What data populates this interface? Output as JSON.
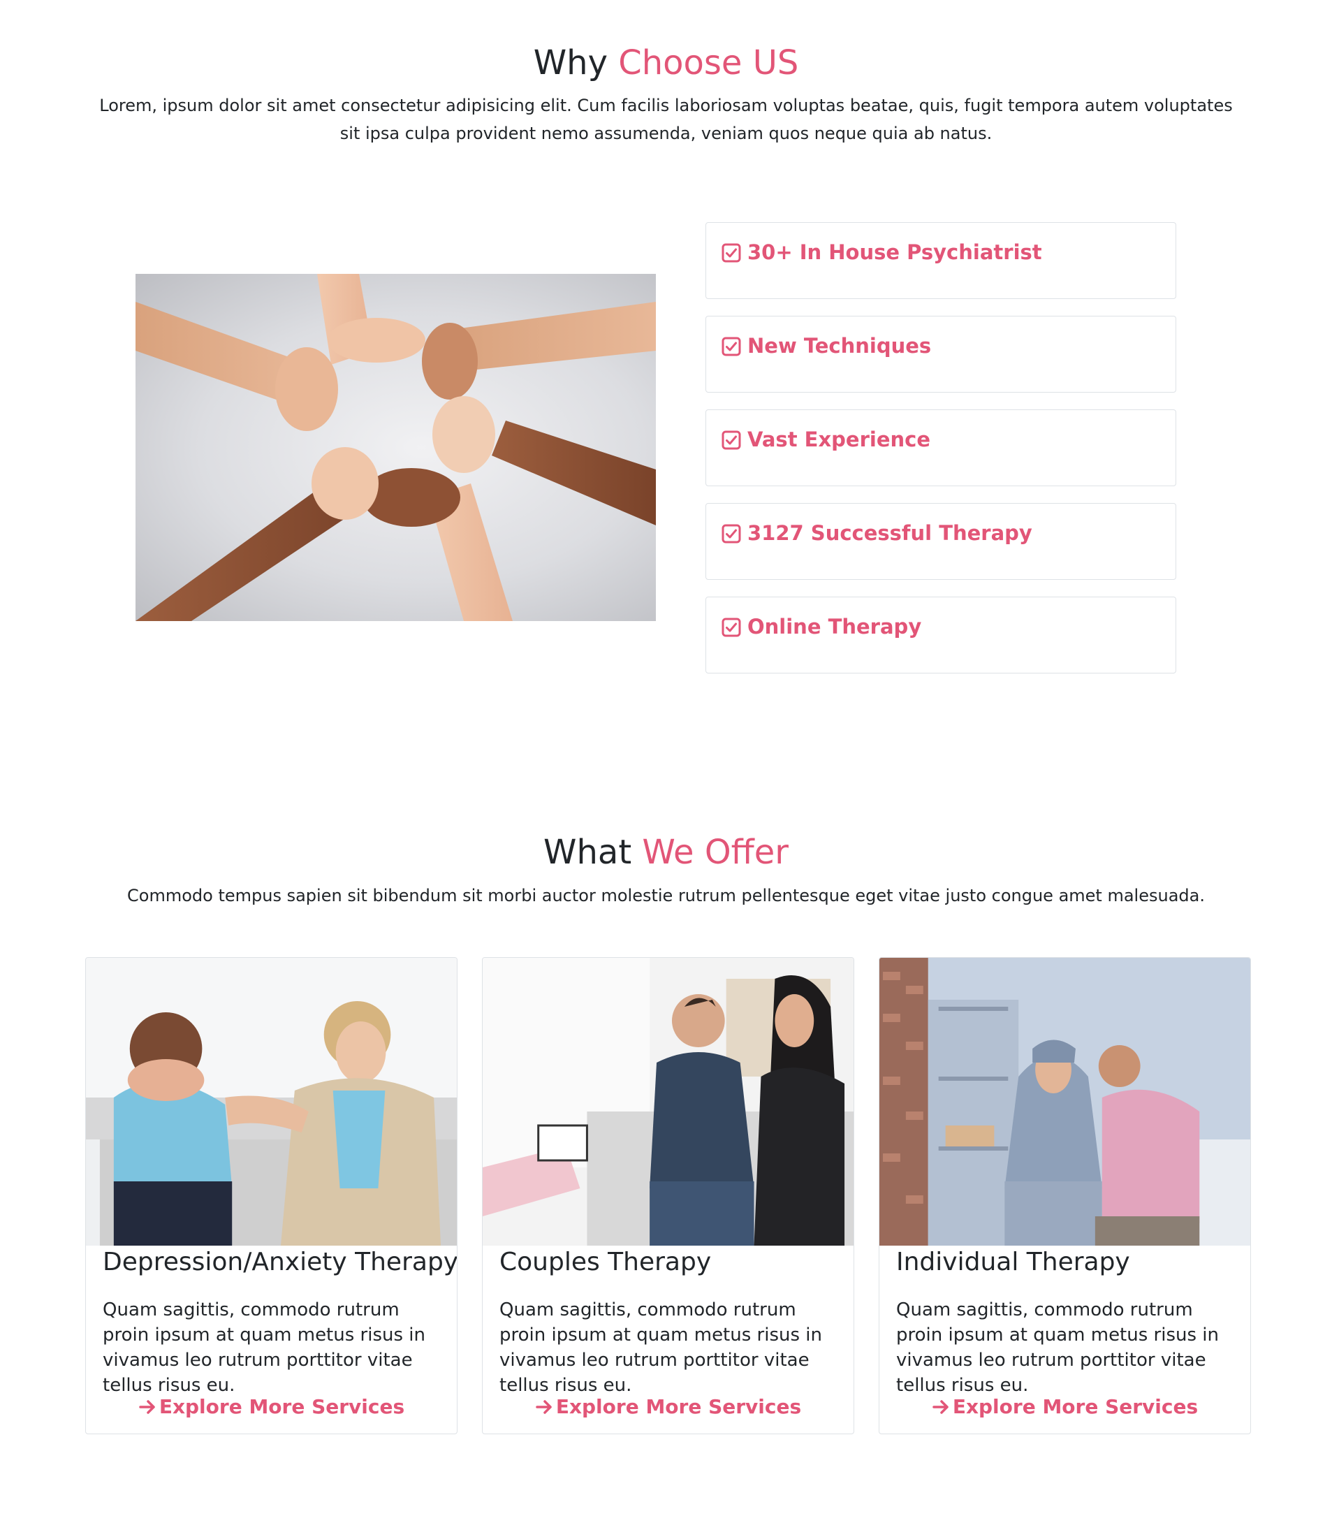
{
  "why_section": {
    "title_plain": "Why ",
    "title_accent": "Choose US",
    "description": "Lorem, ipsum dolor sit amet consectetur adipisicing elit. Cum facilis laboriosam voluptas beatae, quis, fugit tempora autem voluptates sit ipsa culpa provident nemo assumenda, veniam quos neque quia ab natus.",
    "features": [
      {
        "icon": "check-square-icon",
        "label": "30+ In House Psychiatrist"
      },
      {
        "icon": "check-square-icon",
        "label": "New Techniques"
      },
      {
        "icon": "check-square-icon",
        "label": "Vast Experience"
      },
      {
        "icon": "check-square-icon",
        "label": "3127 Successful Therapy"
      },
      {
        "icon": "check-square-icon",
        "label": "Online Therapy"
      }
    ]
  },
  "offer_section": {
    "title_plain": "What ",
    "title_accent": "We Offer",
    "description": "Commodo tempus sapien sit bibendum sit morbi auctor molestie rutrum pellentesque eget vitae justo congue amet malesuada.",
    "cards": [
      {
        "title": "Depression/Anxiety Therapy",
        "text": "Quam sagittis, commodo rutrum proin ipsum at quam metus risus in vivamus leo rutrum porttitor vitae tellus risus eu.",
        "link": "Explore More Services"
      },
      {
        "title": "Couples Therapy",
        "text": "Quam sagittis, commodo rutrum proin ipsum at quam metus risus in vivamus leo rutrum porttitor vitae tellus risus eu.",
        "link": "Explore More Services"
      },
      {
        "title": "Individual Therapy",
        "text": "Quam sagittis, commodo rutrum proin ipsum at quam metus risus in vivamus leo rutrum porttitor vitae tellus risus eu.",
        "link": "Explore More Services"
      }
    ]
  },
  "colors": {
    "accent": "#e25577",
    "text": "#212529",
    "border": "#dee2e6"
  }
}
